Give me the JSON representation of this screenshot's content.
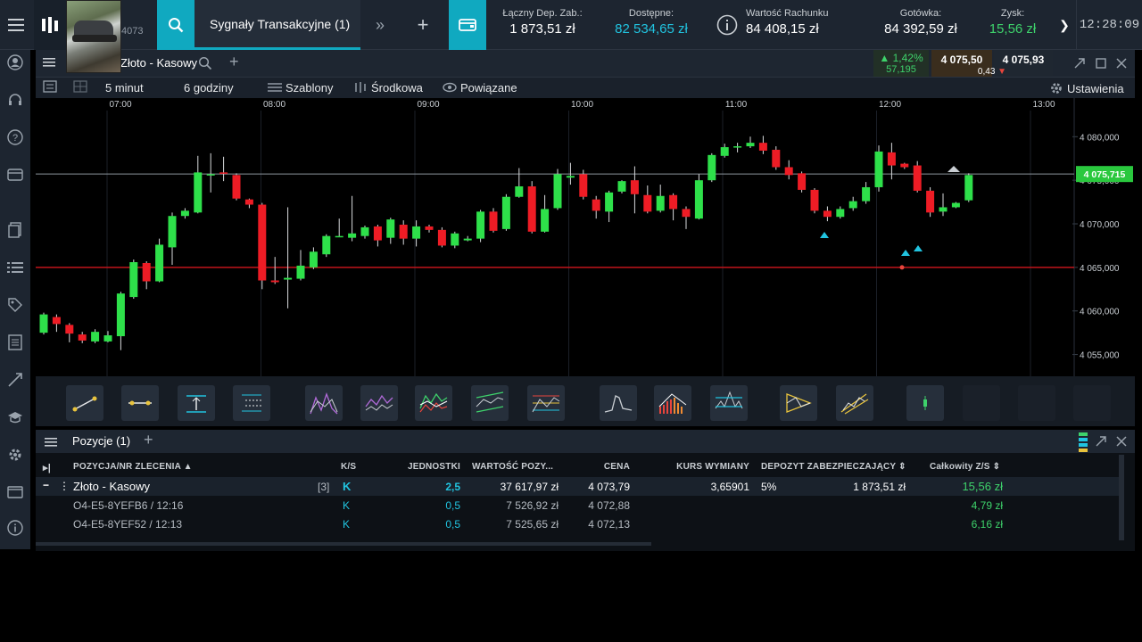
{
  "topbar": {
    "account_number": "4073",
    "tab_label": "Sygnały Transakcyjne (1)",
    "stats": [
      {
        "label": "Łączny Dep. Zab.:",
        "value": "1 873,51 zł",
        "color": "#ffffff"
      },
      {
        "label": "Dostępne:",
        "value": "82 534,65 zł",
        "color": "#21c4e0"
      },
      {
        "label": "Wartość Rachunku",
        "value": "84 408,15 zł",
        "color": "#ffffff"
      },
      {
        "label": "Gotówka:",
        "value": "84 392,59 zł",
        "color": "#ffffff"
      },
      {
        "label": "Zysk:",
        "value": "15,56 zł",
        "color": "#3ed26b"
      }
    ],
    "clock": "12:28:09"
  },
  "chart": {
    "title": "Złoto - Kasowy",
    "change_pct": "1,42%",
    "change_abs": "57,195",
    "bid": "4 075,50",
    "ask": "4 075,93",
    "spread": "0,43",
    "toolbar": {
      "interval": "5 minut",
      "range": "6 godziny",
      "templates": "Szablony",
      "average": "Środkowa",
      "linked": "Powiązane",
      "settings": "Ustawienia"
    }
  },
  "chart_data": {
    "type": "candlestick",
    "time_labels": [
      "07:00",
      "08:00",
      "09:00",
      "10:00",
      "11:00",
      "12:00",
      "13:00"
    ],
    "price_labels": [
      "4 080,000",
      "4 075,000",
      "4 070,000",
      "4 065,000",
      "4 060,000",
      "4 055,000"
    ],
    "current_price_label": "4 075,715",
    "current_price": 4075.715,
    "ylim": [
      4052.5,
      4083.0
    ],
    "horizontal_line": 4065.0,
    "candles": [
      [
        4057.5,
        4059.6,
        4059.8,
        4057.3
      ],
      [
        4059.3,
        4058.5,
        4059.6,
        4057.6
      ],
      [
        4058.4,
        4057.4,
        4058.6,
        4056.4
      ],
      [
        4057.3,
        4056.6,
        4057.6,
        4056.3
      ],
      [
        4056.5,
        4057.6,
        4057.9,
        4056.3
      ],
      [
        4056.5,
        4057.2,
        4057.7,
        4056.4
      ],
      [
        4057.1,
        4062.0,
        4062.2,
        4055.5
      ],
      [
        4061.6,
        4065.6,
        4065.9,
        4061.4
      ],
      [
        4065.5,
        4063.4,
        4065.7,
        4062.5
      ],
      [
        4063.4,
        4067.6,
        4068.3,
        4063.3
      ],
      [
        4067.3,
        4070.9,
        4071.3,
        4065.3
      ],
      [
        4070.9,
        4071.5,
        4071.8,
        4070.6
      ],
      [
        4071.3,
        4075.9,
        4077.8,
        4071.2
      ],
      [
        4075.7,
        4075.7,
        4078.1,
        4073.6
      ],
      [
        4075.9,
        4075.8,
        4077.7,
        4074.9
      ],
      [
        4075.6,
        4072.9,
        4075.8,
        4072.7
      ],
      [
        4072.8,
        4072.2,
        4072.9,
        4071.8
      ],
      [
        4072.2,
        4063.5,
        4072.4,
        4062.5
      ],
      [
        4063.5,
        4063.3,
        4066.2,
        4063.1
      ],
      [
        4063.6,
        4063.8,
        4071.9,
        4060.3
      ],
      [
        4063.7,
        4065.2,
        4067.0,
        4063.5
      ],
      [
        4065.0,
        4066.8,
        4067.3,
        4064.8
      ],
      [
        4066.5,
        4068.6,
        4068.8,
        4066.2
      ],
      [
        4068.6,
        4068.6,
        4070.6,
        4068.5
      ],
      [
        4068.4,
        4068.9,
        4073.2,
        4068.0
      ],
      [
        4068.6,
        4069.6,
        4069.8,
        4068.3
      ],
      [
        4069.7,
        4068.1,
        4069.9,
        4067.4
      ],
      [
        4068.4,
        4070.5,
        4070.7,
        4067.7
      ],
      [
        4069.9,
        4068.3,
        4070.4,
        4067.6
      ],
      [
        4068.3,
        4069.7,
        4070.4,
        4067.4
      ],
      [
        4069.7,
        4069.3,
        4069.9,
        4069.0
      ],
      [
        4069.3,
        4067.5,
        4069.6,
        4067.3
      ],
      [
        4067.5,
        4068.9,
        4069.1,
        4067.2
      ],
      [
        4068.1,
        4068.3,
        4068.6,
        4068.0
      ],
      [
        4068.3,
        4071.4,
        4071.6,
        4067.9
      ],
      [
        4071.4,
        4069.2,
        4071.8,
        4069.0
      ],
      [
        4069.4,
        4073.1,
        4073.4,
        4069.2
      ],
      [
        4073.1,
        4074.3,
        4076.4,
        4073.0
      ],
      [
        4074.3,
        4069.1,
        4074.9,
        4068.9
      ],
      [
        4069.1,
        4071.7,
        4073.3,
        4069.0
      ],
      [
        4071.8,
        4075.7,
        4076.3,
        4071.6
      ],
      [
        4075.3,
        4075.5,
        4077.0,
        4074.5
      ],
      [
        4075.7,
        4073.1,
        4076.2,
        4072.8
      ],
      [
        4072.8,
        4071.5,
        4073.2,
        4070.6
      ],
      [
        4071.4,
        4073.6,
        4073.8,
        4070.2
      ],
      [
        4073.7,
        4074.9,
        4075.0,
        4073.5
      ],
      [
        4075.0,
        4073.4,
        4076.6,
        4071.2
      ],
      [
        4073.3,
        4071.4,
        4074.4,
        4071.2
      ],
      [
        4071.5,
        4073.2,
        4074.5,
        4071.3
      ],
      [
        4073.3,
        4071.7,
        4073.5,
        4070.4
      ],
      [
        4071.7,
        4070.8,
        4072.0,
        4069.4
      ],
      [
        4070.6,
        4075.0,
        4075.7,
        4070.5
      ],
      [
        4075.0,
        4077.9,
        4078.1,
        4074.8
      ],
      [
        4077.8,
        4078.8,
        4079.2,
        4077.6
      ],
      [
        4078.8,
        4078.9,
        4079.3,
        4078.2
      ],
      [
        4078.9,
        4079.3,
        4080.0,
        4078.7
      ],
      [
        4079.3,
        4078.4,
        4080.1,
        4078.0
      ],
      [
        4078.5,
        4076.5,
        4078.9,
        4076.2
      ],
      [
        4076.5,
        4075.6,
        4077.3,
        4075.1
      ],
      [
        4075.8,
        4073.9,
        4076.0,
        4073.6
      ],
      [
        4073.9,
        4071.5,
        4074.1,
        4071.2
      ],
      [
        4071.5,
        4070.8,
        4072.0,
        4070.3
      ],
      [
        4070.8,
        4071.7,
        4072.0,
        4070.6
      ],
      [
        4071.8,
        4072.6,
        4073.1,
        4071.5
      ],
      [
        4072.6,
        4074.2,
        4074.8,
        4072.3
      ],
      [
        4074.2,
        4078.3,
        4079.0,
        4073.7
      ],
      [
        4078.2,
        4076.7,
        4079.3,
        4075.1
      ],
      [
        4076.9,
        4076.5,
        4077.0,
        4076.3
      ],
      [
        4076.7,
        4073.8,
        4077.2,
        4073.6
      ],
      [
        4073.8,
        4071.3,
        4074.2,
        4070.8
      ],
      [
        4071.4,
        4071.9,
        4073.5,
        4070.9
      ],
      [
        4071.9,
        4072.4,
        4072.5,
        4071.8
      ],
      [
        4072.7,
        4075.6,
        4075.8,
        4072.5
      ]
    ]
  },
  "positions": {
    "title": "Pozycje (1)",
    "columns": [
      "POZYCJA/NR ZLECENIA",
      "K/S",
      "JEDNOSTKI",
      "WARTOŚĆ POZY...",
      "CENA",
      "KURS WYMIANY",
      "DEPOZYT ZABEZPIECZAJĄCY",
      "Całkowity Z/S"
    ],
    "main_row": {
      "name": "Złoto - Kasowy",
      "count": "[3]",
      "side": "K",
      "units": "2,5",
      "value": "37 617,97 zł",
      "price": "4 073,79",
      "fx": "3,65901",
      "margin_pct": "5%",
      "margin": "1 873,51 zł",
      "pl": "15,56 zł"
    },
    "orders": [
      {
        "name": "O4-E5-8YEFB6 / 12:16",
        "side": "K",
        "units": "0,5",
        "value": "7 526,92 zł",
        "price": "4 072,88",
        "pl": "4,79 zł"
      },
      {
        "name": "O4-E5-8YEF52 / 12:13",
        "side": "K",
        "units": "0,5",
        "value": "7 525,65 zł",
        "price": "4 072,13",
        "pl": "6,16 zł"
      }
    ]
  }
}
